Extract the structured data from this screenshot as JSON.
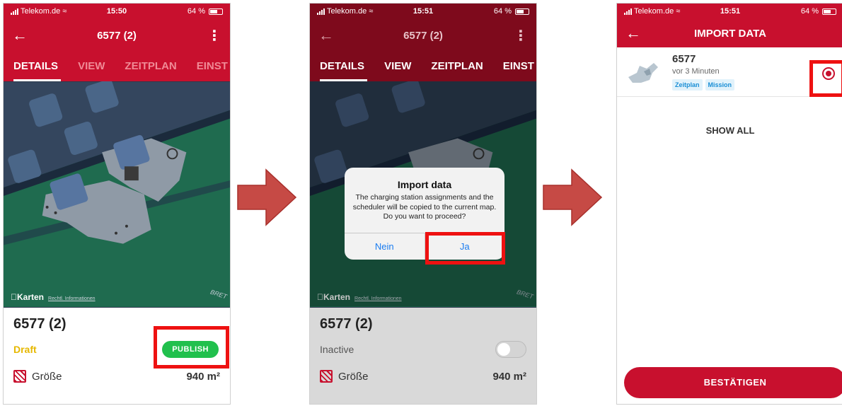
{
  "colors": {
    "brand_red": "#c8102e",
    "highlight": "#ee1111",
    "publish_green": "#21c04d",
    "draft_yellow": "#e6b800",
    "link_blue": "#1a7cf0"
  },
  "screen1": {
    "status": {
      "carrier": "Telekom.de",
      "time": "15:50",
      "battery": "64 %"
    },
    "title": "6577 (2)",
    "tabs": [
      "DETAILS",
      "VIEW",
      "ZEITPLAN",
      "EINST"
    ],
    "map_credit": {
      "brand": "Karten",
      "legal": "Rechtl. Informationen",
      "label": "BRET"
    },
    "map_name": "6577 (2)",
    "state": "Draft",
    "publish_label": "PUBLISH",
    "size_label": "Größe",
    "size_value": "940 m²"
  },
  "screen2": {
    "status": {
      "carrier": "Telekom.de",
      "time": "15:51",
      "battery": "64 %"
    },
    "title": "6577 (2)",
    "tabs": [
      "DETAILS",
      "VIEW",
      "ZEITPLAN",
      "EINST"
    ],
    "map_credit": {
      "brand": "Karten",
      "legal": "Rechtl. Informationen",
      "label": "BRET"
    },
    "map_name": "6577 (2)",
    "state": "Inactive",
    "size_label": "Größe",
    "size_value": "940 m²",
    "dialog": {
      "title": "Import data",
      "message": "The charging station assignments and the scheduler will be copied to the current map. Do you want to proceed?",
      "cancel": "Nein",
      "confirm": "Ja"
    }
  },
  "screen3": {
    "status": {
      "carrier": "Telekom.de",
      "time": "15:51",
      "battery": "64 %"
    },
    "title": "IMPORT DATA",
    "item": {
      "name": "6577",
      "time": "vor 3 Minuten",
      "chips": [
        "Zeitplan",
        "Mission"
      ]
    },
    "show_all": "SHOW ALL",
    "confirm": "BESTÄTIGEN"
  }
}
